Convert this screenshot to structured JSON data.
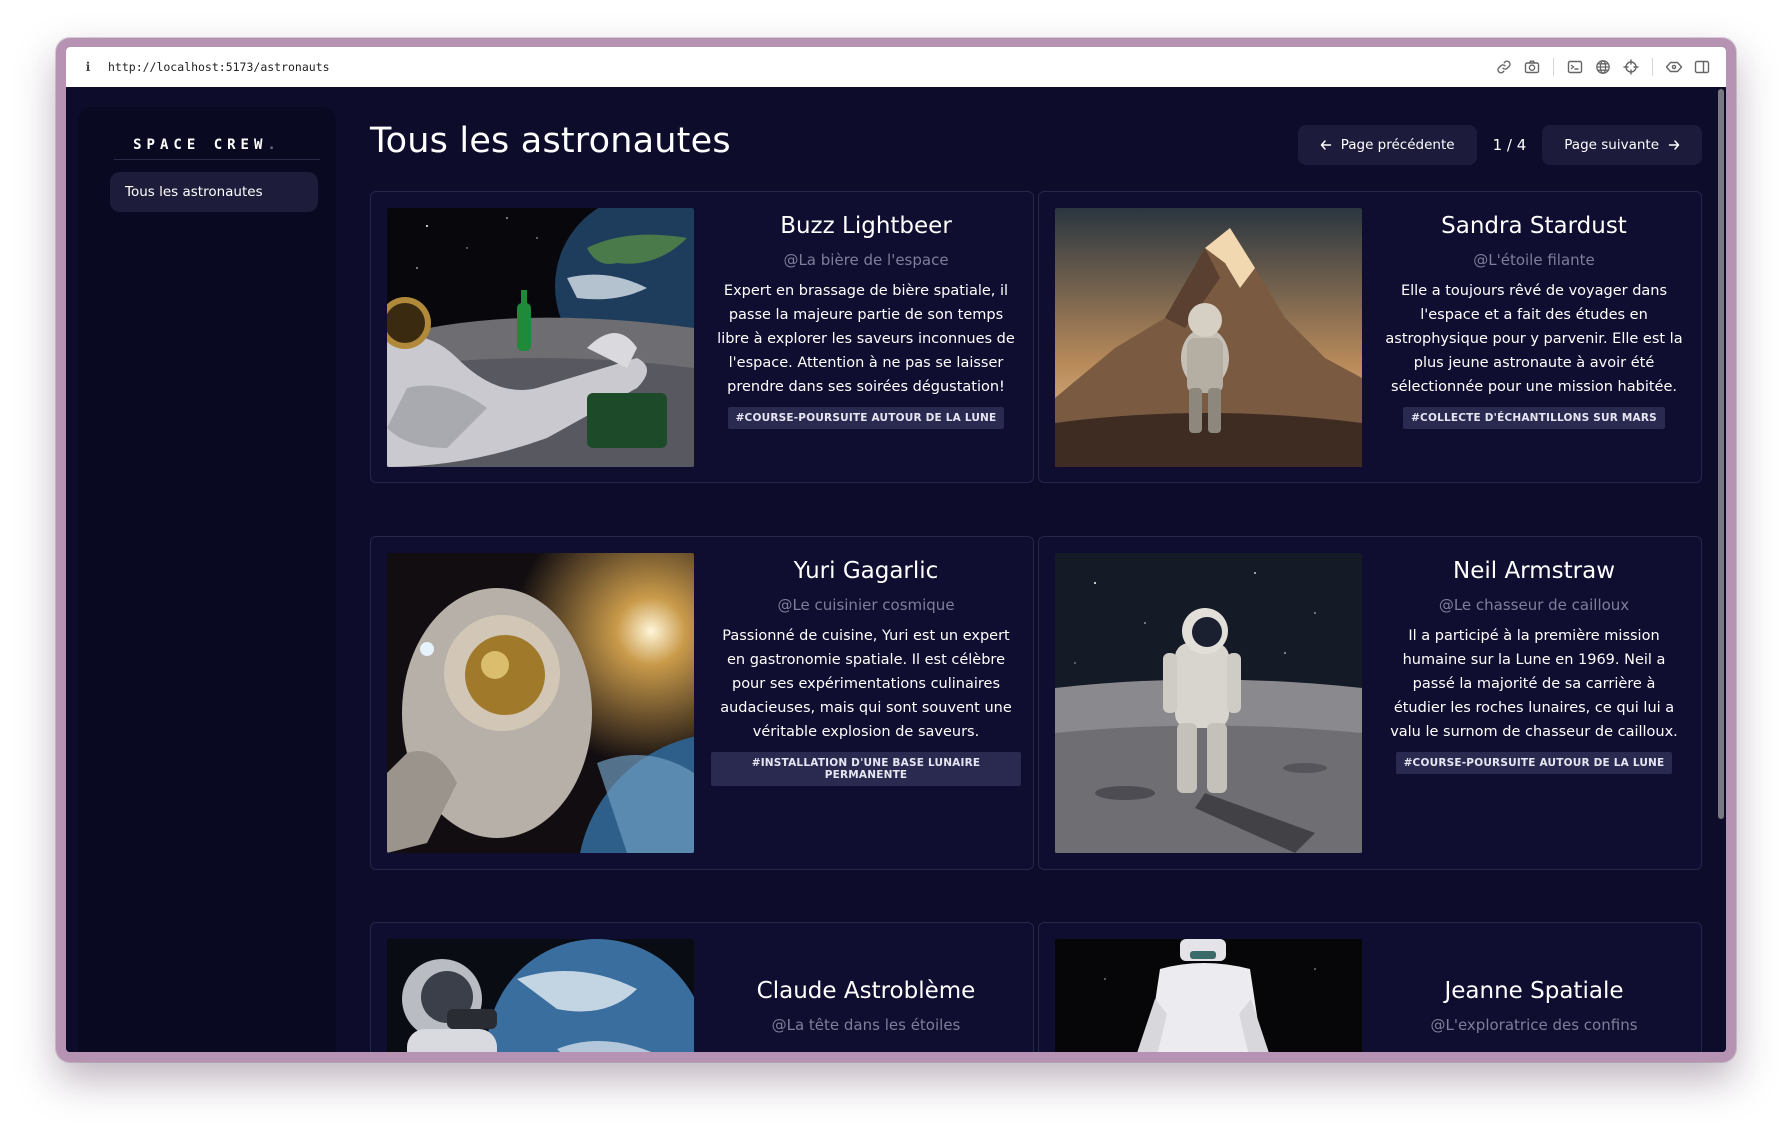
{
  "browser": {
    "url": "http://localhost:5173/astronauts",
    "info_icon": "i"
  },
  "sidebar": {
    "logo": "SPACE CREW",
    "logo_accent": ".",
    "items": [
      {
        "label": "Tous les astronautes",
        "active": true
      }
    ]
  },
  "main": {
    "title": "Tous les astronautes",
    "pagination": {
      "prev_label": "Page précédente",
      "next_label": "Page suivante",
      "indicator": "1 / 4"
    },
    "astronauts": [
      {
        "name": "Buzz Lightbeer",
        "handle": "@La bière de l'espace",
        "bio": "Expert en brassage de bière spatiale, il passe la majeure partie de son temps libre à explorer les saveurs inconnues de l'espace. Attention à ne pas se laisser prendre dans ses soirées dégustation!",
        "tag": "#COURSE-POURSUITE AUTOUR DE LA LUNE"
      },
      {
        "name": "Sandra Stardust",
        "handle": "@L'étoile filante",
        "bio": "Elle a toujours rêvé de voyager dans l'espace et a fait des études en astrophysique pour y parvenir. Elle est la plus jeune astronaute à avoir été sélectionnée pour une mission habitée.",
        "tag": "#COLLECTE D'ÉCHANTILLONS SUR MARS"
      },
      {
        "name": "Yuri Gagarlic",
        "handle": "@Le cuisinier cosmique",
        "bio": "Passionné de cuisine, Yuri est un expert en gastronomie spatiale. Il est célèbre pour ses expérimentations culinaires audacieuses, mais qui sont souvent une véritable explosion de saveurs.",
        "tag": "#INSTALLATION D'UNE BASE LUNAIRE PERMANENTE"
      },
      {
        "name": "Neil Armstraw",
        "handle": "@Le chasseur de cailloux",
        "bio": "Il a participé à la première mission humaine sur la Lune en 1969. Neil a passé la majorité de sa carrière à étudier les roches lunaires, ce qui lui a valu le surnom de chasseur de cailloux.",
        "tag": "#COURSE-POURSUITE AUTOUR DE LA LUNE"
      },
      {
        "name": "Claude Astroblème",
        "handle": "@La tête dans les étoiles",
        "bio": "",
        "tag": ""
      },
      {
        "name": "Jeanne Spatiale",
        "handle": "@L'exploratrice des confins",
        "bio": "",
        "tag": ""
      }
    ]
  },
  "icons": {
    "toolbar": [
      "link-icon",
      "camera-icon",
      "terminal-icon",
      "globe-icon",
      "crosshair-icon",
      "extensions-icon",
      "split-view-icon"
    ],
    "prev": "arrow-left-icon",
    "next": "arrow-right-icon"
  },
  "colors": {
    "window_frame": "#b693b3",
    "app_background": "#0d0c2b",
    "sidebar_background": "#090922",
    "card_background": "#0f0e30",
    "button_background": "#1c1b3b",
    "tag_background": "#2a2950",
    "muted_text": "#7e7e9a"
  }
}
